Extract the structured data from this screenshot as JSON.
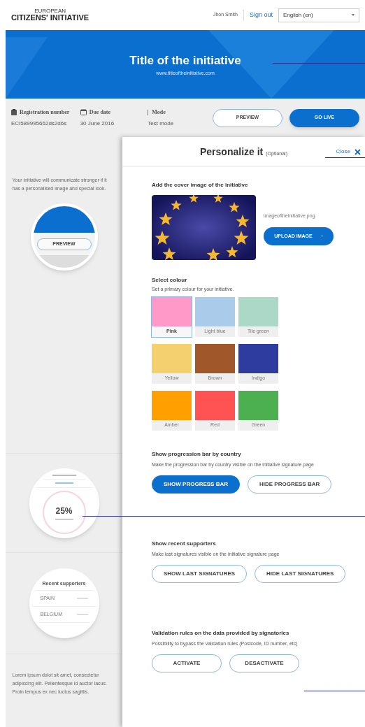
{
  "header": {
    "logo_top": "EUROPEAN",
    "logo_bottom": "CITIZENS' INITIATIVE",
    "user": "Jhon Smith",
    "sign_out": "Sign out",
    "language": "English (en)"
  },
  "banner": {
    "title": "Title of the initiative",
    "url": "www.titleoftheinitiative.com"
  },
  "info": [
    {
      "label": "Registration number",
      "value": "ECI589995662ds2d6s"
    },
    {
      "label": "Due date",
      "value": "30 June 2016"
    },
    {
      "label": "Mode",
      "value": "Test mode"
    }
  ],
  "actions": [
    {
      "label": "PREVIEW",
      "selected": false
    },
    {
      "label": "GO LIVE",
      "selected": true
    }
  ],
  "sidebar": {
    "intro": "Your initiative will communicate stronger if it has a personalised image and special look.",
    "preview_button": "PREVIEW",
    "progress_percent": "25%",
    "supporters_title": "Recent supporters",
    "supporters": [
      "SPAIN",
      "BELGIUM"
    ],
    "footer": "Lorem ipsum dolot sit amet, consectetur adipiscing elit. Pellentesque id auctor lacus. Proin tempus ex nec luctus sagittis."
  },
  "panel": {
    "title": "Personalize it",
    "optional": "(Optional)",
    "close": "Close",
    "cover": {
      "title": "Add the cover image of the initiative",
      "filename": "imageoftheinitiative.png",
      "upload": "UPLOAD IMAGE"
    },
    "colour": {
      "title": "Select colour",
      "description": "Set a primary colour for your initiative.",
      "swatches": [
        {
          "label": "Pink",
          "color": "#ff99c8",
          "selected": true
        },
        {
          "label": "Light blue",
          "color": "#abcbea",
          "selected": false
        },
        {
          "label": "Tile green",
          "color": "#acd8c8",
          "selected": false
        },
        {
          "label": "Yellow",
          "color": "#f4d06f",
          "selected": false
        },
        {
          "label": "Brown",
          "color": "#a0582a",
          "selected": false
        },
        {
          "label": "Indigo",
          "color": "#2f3c9f",
          "selected": false
        },
        {
          "label": "Amber",
          "color": "#ffa000",
          "selected": false
        },
        {
          "label": "Red",
          "color": "#ff5252",
          "selected": false
        },
        {
          "label": "Green",
          "color": "#4caf50",
          "selected": false
        }
      ]
    },
    "options": [
      {
        "title": "Show progression bar by country",
        "description": "Make the progression bar by country visible on the initiative signature page",
        "buttons": [
          {
            "label": "SHOW PROGRESS BAR",
            "selected": true
          },
          {
            "label": "HIDE PROGRESS BAR",
            "selected": false
          }
        ]
      },
      {
        "title": "Show recent supporters",
        "description": "Make last signatures visible on the initiative signature page",
        "buttons": [
          {
            "label": "SHOW LAST SIGNATURES",
            "selected": false
          },
          {
            "label": "HIDE LAST SIGNATURES",
            "selected": false
          }
        ]
      },
      {
        "title": "Validation rules on the data provided by signatories",
        "description": "Possibility to bypass the validation rules (Postcode, ID number, etc)",
        "buttons": [
          {
            "label": "ACTIVATE",
            "selected": false
          },
          {
            "label": "DESACTIVATE",
            "selected": false
          }
        ]
      }
    ]
  }
}
